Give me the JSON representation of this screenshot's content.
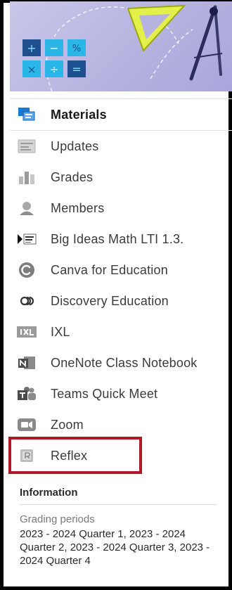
{
  "banner": {
    "tiles": [
      "+",
      "−",
      "%",
      "×",
      "÷",
      "="
    ]
  },
  "nav": {
    "items": [
      {
        "label": "Materials",
        "icon": "materials-icon",
        "active": true
      },
      {
        "label": "Updates",
        "icon": "updates-icon"
      },
      {
        "label": "Grades",
        "icon": "grades-icon"
      },
      {
        "label": "Members",
        "icon": "members-icon"
      },
      {
        "label": "Big Ideas Math LTI 1.3.",
        "icon": "big-ideas-math-icon"
      },
      {
        "label": "Canva for Education",
        "icon": "canva-icon"
      },
      {
        "label": "Discovery Education",
        "icon": "discovery-education-icon"
      },
      {
        "label": "IXL",
        "icon": "ixl-icon"
      },
      {
        "label": "OneNote Class Notebook",
        "icon": "onenote-icon"
      },
      {
        "label": "Teams Quick Meet",
        "icon": "teams-icon"
      },
      {
        "label": "Zoom",
        "icon": "zoom-icon"
      },
      {
        "label": "Reflex",
        "icon": "reflex-icon",
        "highlighted": true
      }
    ]
  },
  "info": {
    "title": "Information",
    "grading_label": "Grading periods",
    "grading_value": "2023 - 2024 Quarter 1, 2023 - 2024 Quarter 2, 2023 - 2024 Quarter 3, 2023 - 2024 Quarter 4"
  },
  "colors": {
    "highlight_box": "#b01825",
    "banner_bg": "#b6b3e0",
    "tile_dark": "#1e4f8f",
    "tile_light": "#2ab6e6"
  }
}
